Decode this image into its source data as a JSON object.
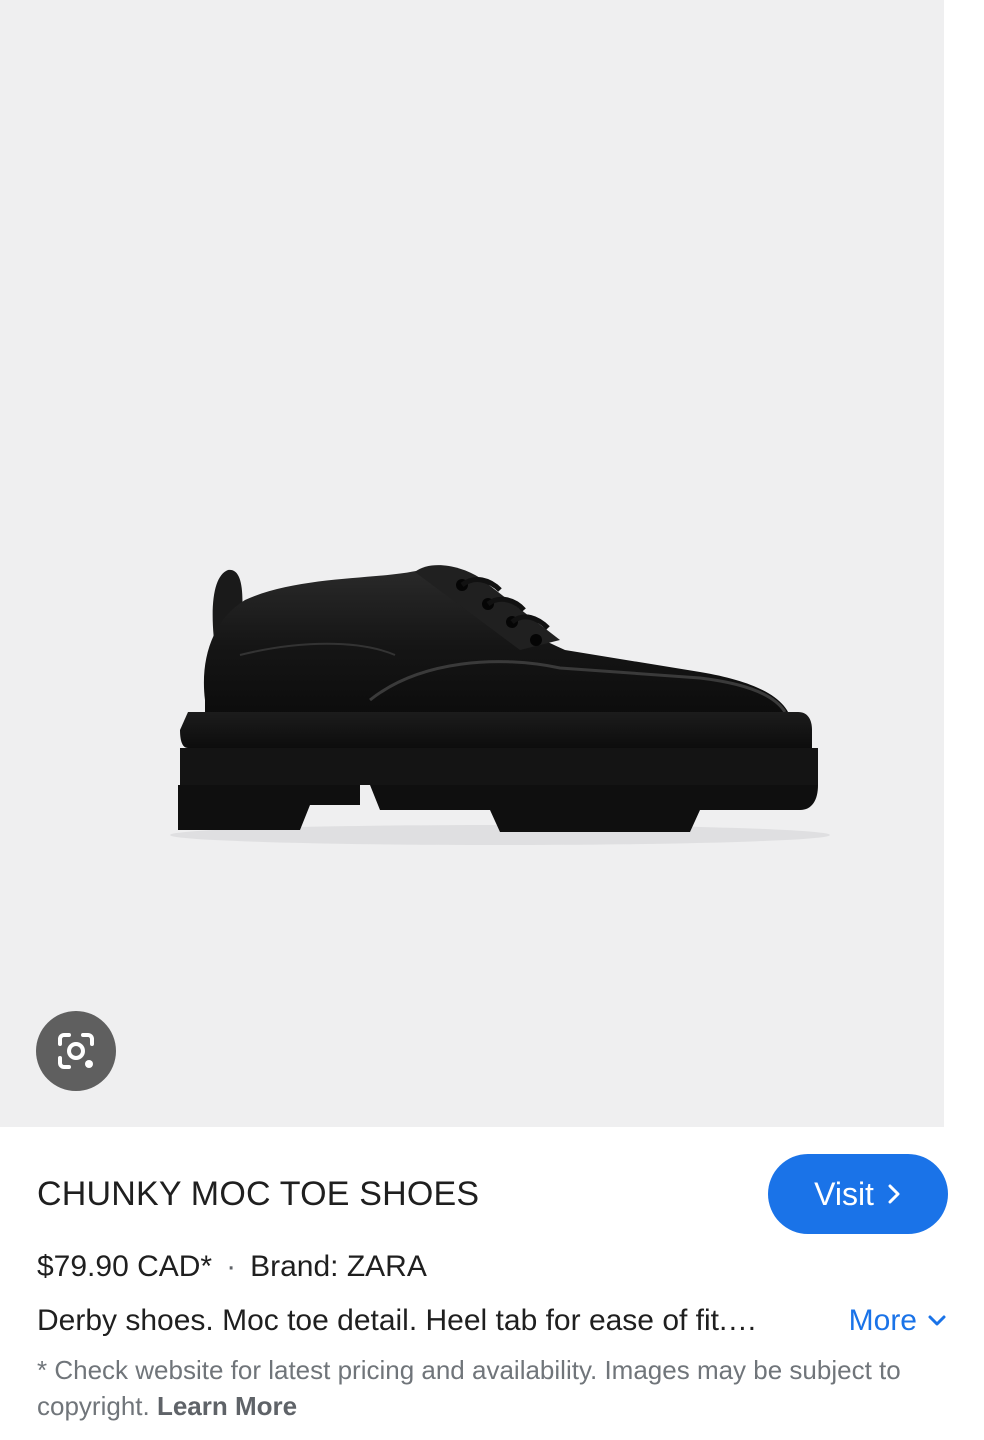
{
  "product": {
    "title": "CHUNKY MOC TOE SHOES",
    "price": "$79.90 CAD*",
    "separator": "·",
    "brand": "Brand: ZARA",
    "description": "Derby shoes. Moc toe detail. Heel tab for ease of fit.…",
    "image_subject": "black chunky moc toe derby shoe"
  },
  "actions": {
    "visit_label": "Visit",
    "more_label": "More",
    "lens_icon": "google-lens-icon"
  },
  "disclaimer": {
    "text": "* Check website for latest pricing and availability. Images may be subject to copyright.",
    "learn_more": "Learn More"
  },
  "colors": {
    "accent": "#1a73e8",
    "image_background": "#efeff0",
    "lens_button": "#5f5f5f",
    "text_primary": "#1f1f1f",
    "text_secondary": "#70757a"
  }
}
